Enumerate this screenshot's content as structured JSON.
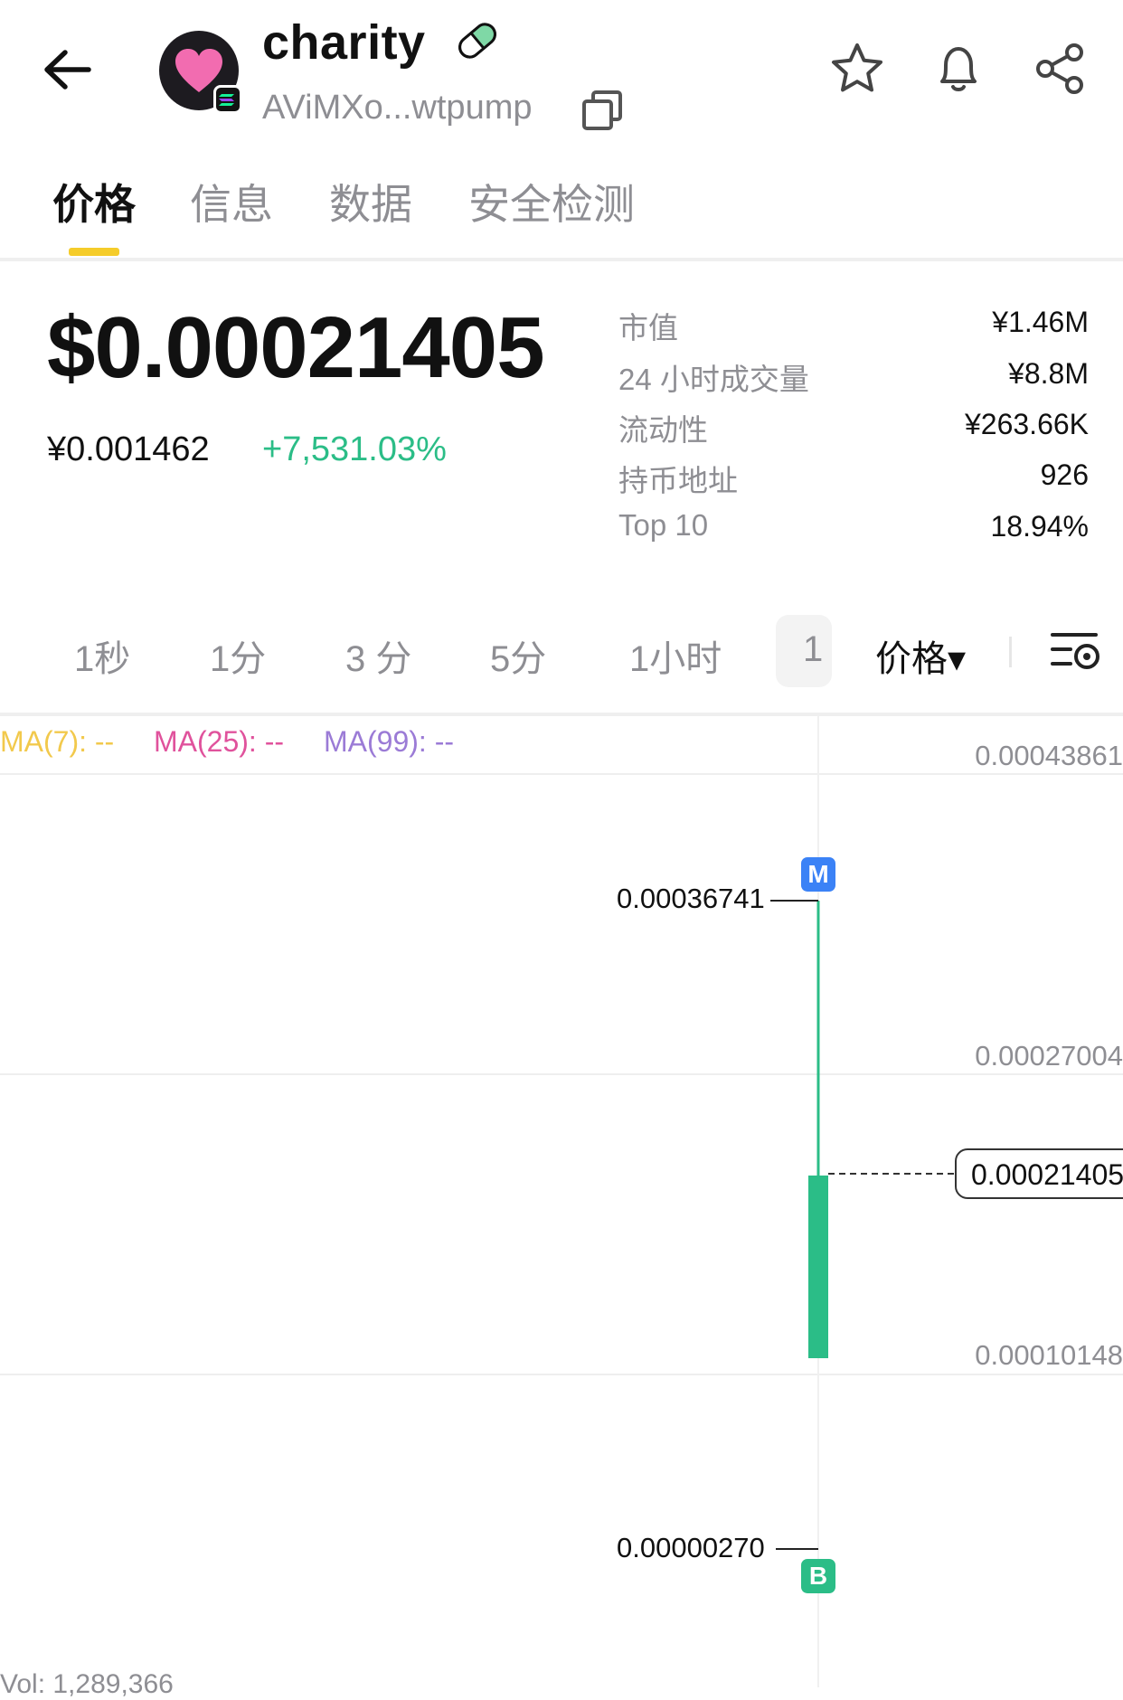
{
  "header": {
    "token_name": "charity",
    "address": "AViMXo...wtpump",
    "icons": [
      "back-arrow-icon",
      "heart-icon",
      "solana-icon",
      "pill-icon",
      "copy-icon",
      "star-icon",
      "bell-icon",
      "share-icon"
    ]
  },
  "tabs": [
    {
      "label": "价格",
      "active": true
    },
    {
      "label": "信息",
      "active": false
    },
    {
      "label": "数据",
      "active": false
    },
    {
      "label": "安全检测",
      "active": false
    }
  ],
  "price": {
    "usd": "$0.00021405",
    "cny": "¥0.001462",
    "change": "+7,531.03%"
  },
  "stats": [
    {
      "label": "市值",
      "value": "¥1.46M"
    },
    {
      "label": "24 小时成交量",
      "value": "¥8.8M"
    },
    {
      "label": "流动性",
      "value": "¥263.66K"
    },
    {
      "label": "持币地址",
      "value": "926"
    },
    {
      "label": "Top 10",
      "value": "18.94%"
    }
  ],
  "intervals": [
    "1秒",
    "1分",
    "3 分",
    "5分",
    "1小时",
    "1"
  ],
  "price_mode": "价格▾",
  "ma": [
    {
      "label": "MA(7): --",
      "color": "#f2c94c"
    },
    {
      "label": "MA(25): --",
      "color": "#e0529c"
    },
    {
      "label": "MA(99): --",
      "color": "#9b7bd6"
    }
  ],
  "chart": {
    "y_labels": [
      "0.00043861",
      "0.00027004",
      "0.00010148"
    ],
    "current_price_label": "0.00021405",
    "high_label": "0.00036741",
    "low_label": "0.00000270",
    "markers": {
      "m": "M",
      "b": "B"
    },
    "volume": "Vol: 1,289,366"
  },
  "colors": {
    "up": "#2bbd87",
    "accent": "#f5cc2a",
    "muted": "#8e8e93"
  },
  "chart_data": {
    "type": "candlestick",
    "y_ticks": [
      0.00043861,
      0.00027004,
      0.00010148
    ],
    "candles": [
      {
        "open": 2.7e-06,
        "high": 0.00036741,
        "low": 2.7e-06,
        "close": 0.00021405
      }
    ],
    "current_price": 0.00021405,
    "volume": 1289366
  }
}
